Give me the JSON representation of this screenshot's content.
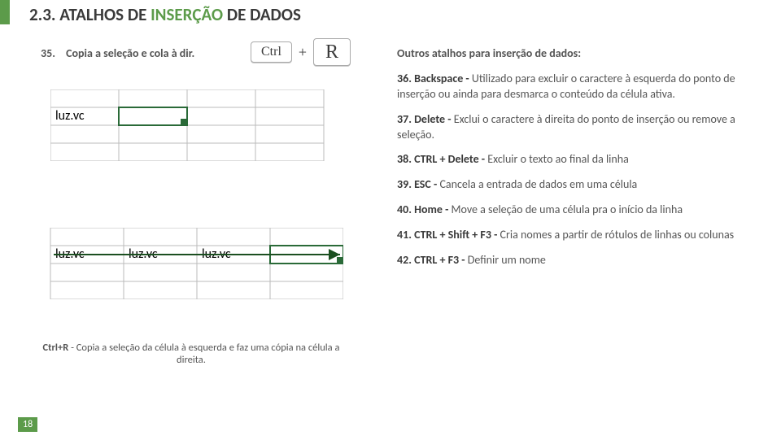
{
  "section": {
    "number": "2.3.",
    "pre": "ATALHOS DE ",
    "accent": "INSERÇÃO",
    "post": " DE DADOS"
  },
  "item35": {
    "num": "35.",
    "text": "Copia a seleção e cola à dir."
  },
  "keys": {
    "ctrl": "Ctrl",
    "plus": "+",
    "r": "R"
  },
  "right": {
    "intro": "Outros atalhos para inserção de dados:",
    "i36_num": "36. ",
    "i36_b": "Backspace - ",
    "i36_t": "Utilizado para excluir o caractere à esquerda do ponto de inserção ou ainda para desmarca o conteúdo da célula ativa.",
    "i37_num": "37. ",
    "i37_b": "Delete - ",
    "i37_t": "Exclui o caractere à direita do ponto de inserção ou remove a seleção.",
    "i38_num": "38. ",
    "i38_b": "CTRL + Delete - ",
    "i38_t": "Excluir o texto ao final da linha",
    "i39_num": "39. ",
    "i39_b": "ESC - ",
    "i39_t": "Cancela a entrada de dados em uma célula",
    "i40_num": "40. ",
    "i40_b": "Home - ",
    "i40_t": "Move a seleção de uma célula pra o início da linha",
    "i41_num": "41. ",
    "i41_b": "CTRL + Shift + F3 - ",
    "i41_t": "Cria nomes a partir de rótulos de linhas ou colunas",
    "i42_num": "42. ",
    "i42_b": "CTRL + F3 - ",
    "i42_t": "Definir um nome"
  },
  "caption": {
    "b": "Ctrl+R",
    "t": " - Copia a seleção da célula à esquerda e faz uma cópia na célula a direita."
  },
  "cells": {
    "luz": "luz.vc"
  },
  "page": "18"
}
